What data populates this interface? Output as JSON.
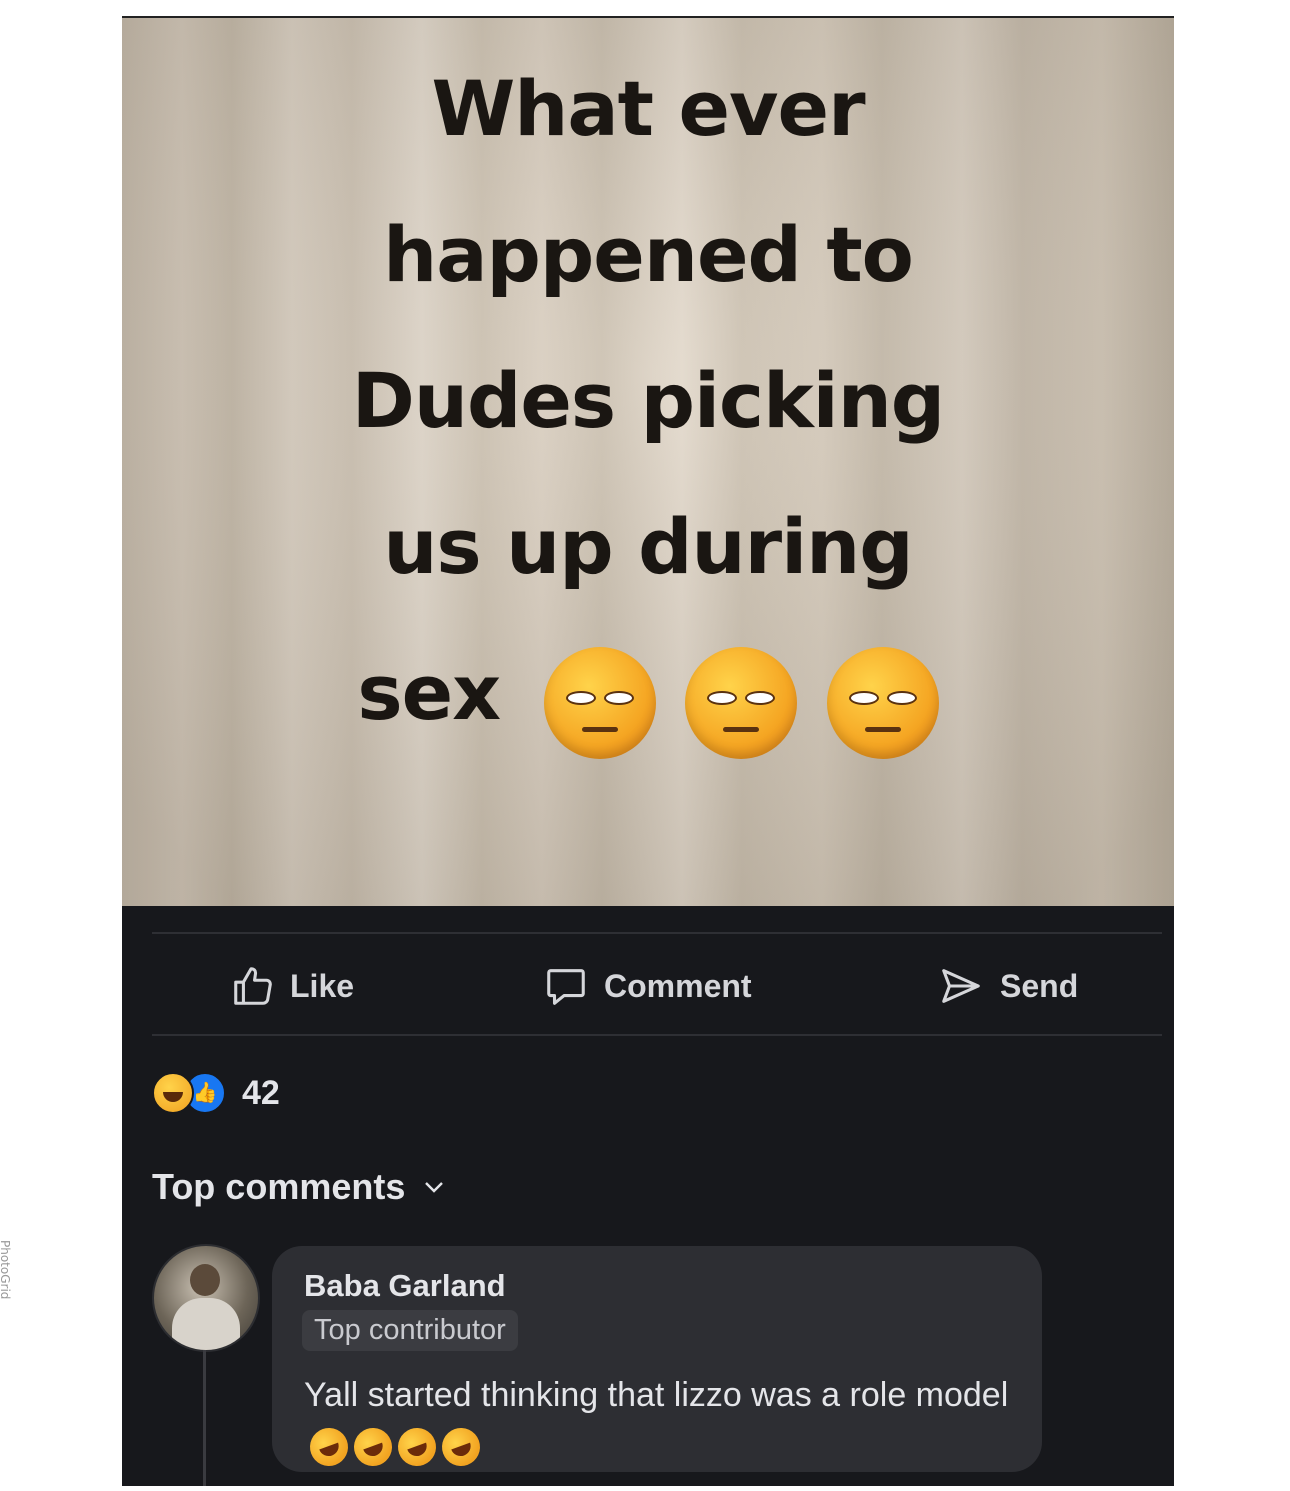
{
  "meme": {
    "lines": [
      "What ever",
      "happened to",
      "Dudes picking",
      "us up during",
      "sex"
    ],
    "emojis": [
      "thinking-face-icon",
      "relieved-face-icon",
      "relieved-face-icon"
    ]
  },
  "actions": {
    "like_label": "Like",
    "comment_label": "Comment",
    "send_label": "Send"
  },
  "reactions": {
    "types": [
      "haha",
      "like"
    ],
    "count": "42"
  },
  "comments_sort": {
    "label": "Top comments"
  },
  "comment": {
    "author": "Baba Garland",
    "badge": "Top contributor",
    "text": "Yall started thinking that lizzo was a role model",
    "emoji_count": 4
  },
  "watermark": "PhotoGrid",
  "colors": {
    "background": "#17181c",
    "bubble": "#2d2e33",
    "text": "#e4e5e9",
    "like_blue": "#1877f2"
  }
}
